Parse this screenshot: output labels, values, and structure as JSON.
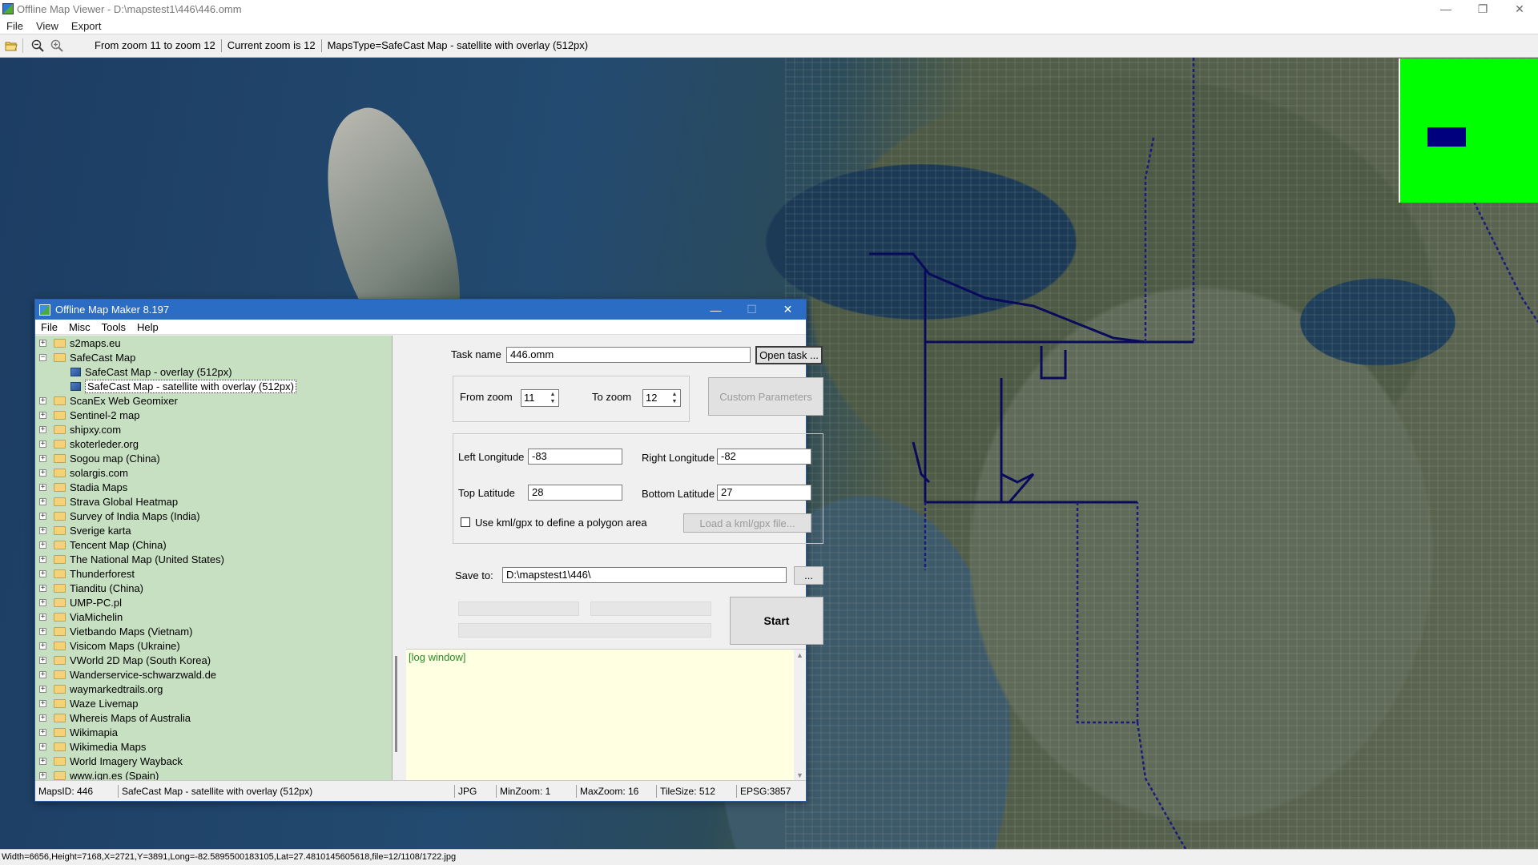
{
  "app": {
    "title": "Offline Map Viewer - D:\\mapstest1\\446\\446.omm",
    "menu": [
      "File",
      "View",
      "Export"
    ],
    "toolbar_info": [
      "From zoom 11 to zoom 12",
      "Current zoom is 12",
      "MapsType=SafeCast Map - satellite with overlay (512px)"
    ],
    "status": "Width=6656,Height=7168,X=2721,Y=3891,Long=-82.5895500183105,Lat=27.4810145605618,file=12/1108/1722.jpg",
    "icons": {
      "open": "folder-open-icon",
      "zoom_out": "zoom-out-icon",
      "zoom_in": "zoom-in-icon"
    },
    "overview_color": "#00ff00",
    "overview_viewbox_color": "#00007f"
  },
  "dialog": {
    "title": "Offline Map Maker 8.197",
    "menu": [
      "File",
      "Misc",
      "Tools",
      "Help"
    ],
    "tree": [
      {
        "label": "s2maps.eu",
        "type": "folder",
        "expanded": false
      },
      {
        "label": "SafeCast Map",
        "type": "folder",
        "expanded": true
      },
      {
        "label": "SafeCast Map - overlay (512px)",
        "type": "leaf"
      },
      {
        "label": "SafeCast Map - satellite with overlay (512px)",
        "type": "leaf",
        "selected": true
      },
      {
        "label": "ScanEx Web Geomixer",
        "type": "folder"
      },
      {
        "label": "Sentinel-2 map",
        "type": "folder"
      },
      {
        "label": "shipxy.com",
        "type": "folder"
      },
      {
        "label": "skoterleder.org",
        "type": "folder"
      },
      {
        "label": "Sogou map (China)",
        "type": "folder"
      },
      {
        "label": "solargis.com",
        "type": "folder"
      },
      {
        "label": "Stadia Maps",
        "type": "folder"
      },
      {
        "label": "Strava Global Heatmap",
        "type": "folder"
      },
      {
        "label": "Survey of India Maps (India)",
        "type": "folder"
      },
      {
        "label": "Sverige karta",
        "type": "folder"
      },
      {
        "label": "Tencent Map (China)",
        "type": "folder"
      },
      {
        "label": "The National Map (United States)",
        "type": "folder"
      },
      {
        "label": "Thunderforest",
        "type": "folder"
      },
      {
        "label": "Tianditu (China)",
        "type": "folder"
      },
      {
        "label": "UMP-PC.pl",
        "type": "folder"
      },
      {
        "label": "ViaMichelin",
        "type": "folder"
      },
      {
        "label": "Vietbando Maps (Vietnam)",
        "type": "folder"
      },
      {
        "label": "Visicom Maps (Ukraine)",
        "type": "folder"
      },
      {
        "label": "VWorld 2D Map (South Korea)",
        "type": "folder"
      },
      {
        "label": "Wanderservice-schwarzwald.de",
        "type": "folder"
      },
      {
        "label": "waymarkedtrails.org",
        "type": "folder"
      },
      {
        "label": "Waze Livemap",
        "type": "folder"
      },
      {
        "label": "Whereis Maps of Australia",
        "type": "folder"
      },
      {
        "label": "Wikimapia",
        "type": "folder"
      },
      {
        "label": "Wikimedia Maps",
        "type": "folder"
      },
      {
        "label": "World Imagery Wayback",
        "type": "folder"
      },
      {
        "label": "www.ign.es (Spain)",
        "type": "folder"
      }
    ],
    "form": {
      "task_name_label": "Task name",
      "task_name_value": "446.omm",
      "open_task_label": "Open task ...",
      "from_zoom_label": "From zoom",
      "from_zoom_value": "11",
      "to_zoom_label": "To zoom",
      "to_zoom_value": "12",
      "custom_params_label": "Custom Parameters",
      "left_lon_label": "Left Longitude",
      "left_lon_value": "-83",
      "right_lon_label": "Right Longitude",
      "right_lon_value": "-82",
      "top_lat_label": "Top Latitude",
      "top_lat_value": "28",
      "bottom_lat_label": "Bottom Latitude",
      "bottom_lat_value": "27",
      "kml_checkbox_label": "Use kml/gpx to define a polygon area",
      "kml_checked": false,
      "load_kml_label": "Load a kml/gpx file...",
      "save_to_label": "Save to:",
      "save_to_value": "D:\\mapstest1\\446\\",
      "browse_label": "...",
      "start_label": "Start",
      "log_text": "[log window]"
    },
    "status": {
      "maps_id": "MapsID: 446",
      "map_name": "SafeCast Map - satellite with overlay (512px)",
      "format": "JPG",
      "min_zoom": "MinZoom: 1",
      "max_zoom": "MaxZoom: 16",
      "tile_size": "TileSize: 512",
      "epsg": "EPSG:3857"
    }
  }
}
